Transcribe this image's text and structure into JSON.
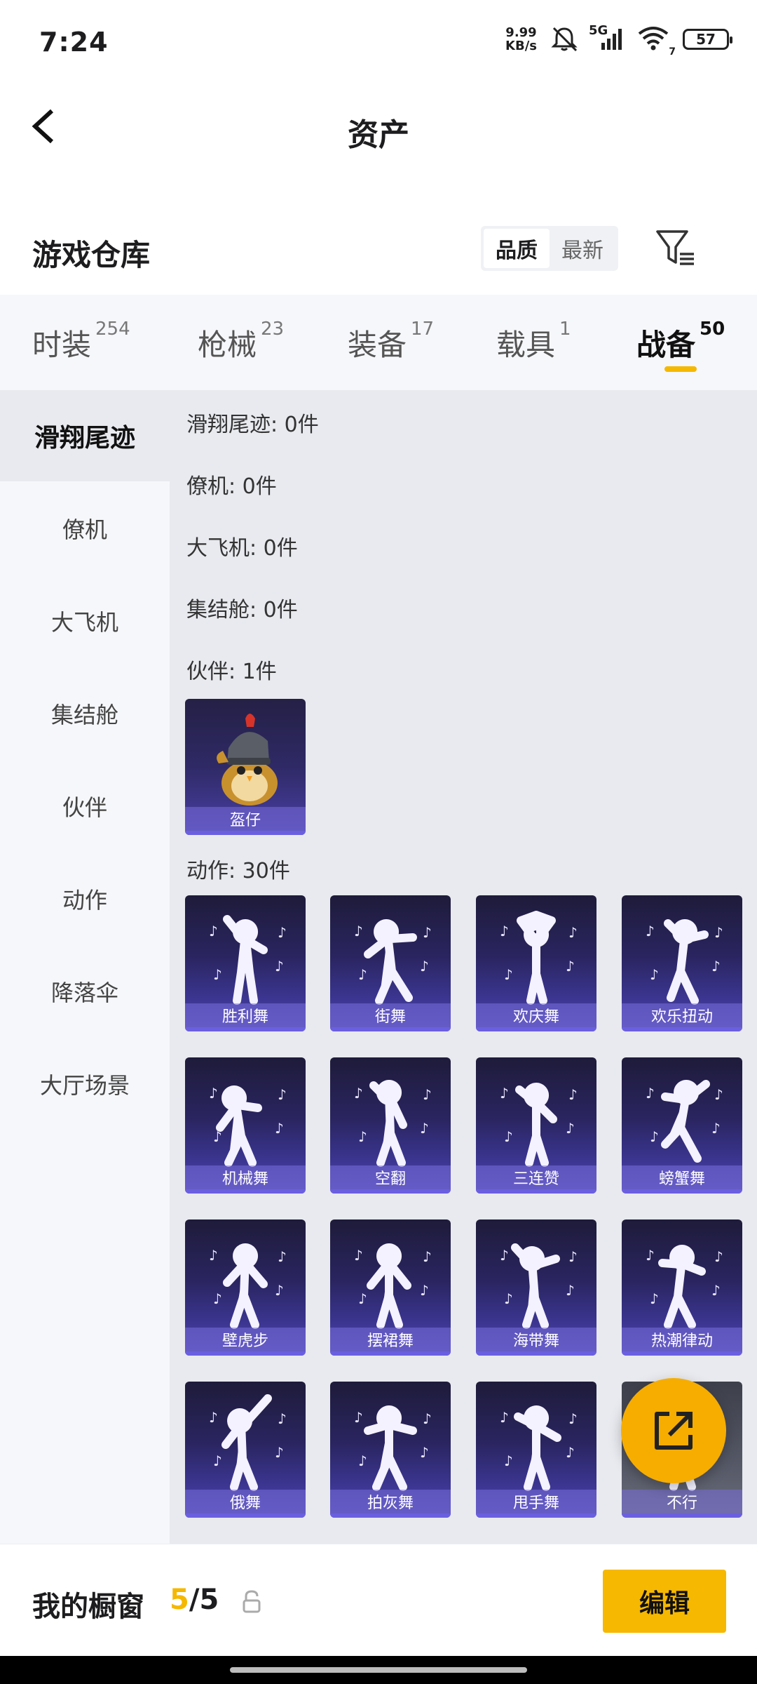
{
  "status_bar": {
    "time": "7:24",
    "net_speed_value": "9.99",
    "net_speed_unit": "KB/s",
    "network": "5G",
    "wifi_badge": "7",
    "battery": "57"
  },
  "header": {
    "title": "资产"
  },
  "section": {
    "title": "游戏仓库",
    "sort_options": [
      "品质",
      "最新"
    ],
    "active_sort": "品质"
  },
  "tabs": [
    {
      "label": "时装",
      "count": "254"
    },
    {
      "label": "枪械",
      "count": "23"
    },
    {
      "label": "装备",
      "count": "17"
    },
    {
      "label": "载具",
      "count": "1"
    },
    {
      "label": "战备",
      "count": "50"
    }
  ],
  "active_tab": "战备",
  "sidebar": {
    "items": [
      "滑翔尾迹",
      "僚机",
      "大飞机",
      "集结舱",
      "伙伴",
      "动作",
      "降落伞",
      "大厅场景"
    ],
    "active": "滑翔尾迹"
  },
  "groups": [
    {
      "label": "滑翔尾迹: 0件"
    },
    {
      "label": "僚机: 0件"
    },
    {
      "label": "大飞机: 0件"
    },
    {
      "label": "集结舱: 0件"
    },
    {
      "label": "伙伴: 1件"
    },
    {
      "label": "动作: 30件"
    }
  ],
  "partner_items": [
    {
      "name": "盔仔"
    }
  ],
  "action_items": [
    {
      "name": "胜利舞"
    },
    {
      "name": "街舞"
    },
    {
      "name": "欢庆舞"
    },
    {
      "name": "欢乐扭动"
    },
    {
      "name": "机械舞"
    },
    {
      "name": "空翻"
    },
    {
      "name": "三连赞"
    },
    {
      "name": "螃蟹舞"
    },
    {
      "name": "壁虎步"
    },
    {
      "name": "摆裙舞"
    },
    {
      "name": "海带舞"
    },
    {
      "name": "热潮律动"
    },
    {
      "name": "俄舞"
    },
    {
      "name": "拍灰舞"
    },
    {
      "name": "甩手舞"
    },
    {
      "name": "不行"
    }
  ],
  "bottom_bar": {
    "title": "我的橱窗",
    "count_current": "5",
    "count_sep": "/",
    "count_total": "5",
    "edit_label": "编辑"
  },
  "colors": {
    "accent": "#f5b800",
    "card_dark": "#1e1b3a",
    "card_light": "#5148b0",
    "fab": "#f6ad00"
  },
  "icons": {
    "back": "chevron-left-icon",
    "filter": "filter-icon",
    "lock": "lock-icon",
    "share": "external-link-icon"
  }
}
